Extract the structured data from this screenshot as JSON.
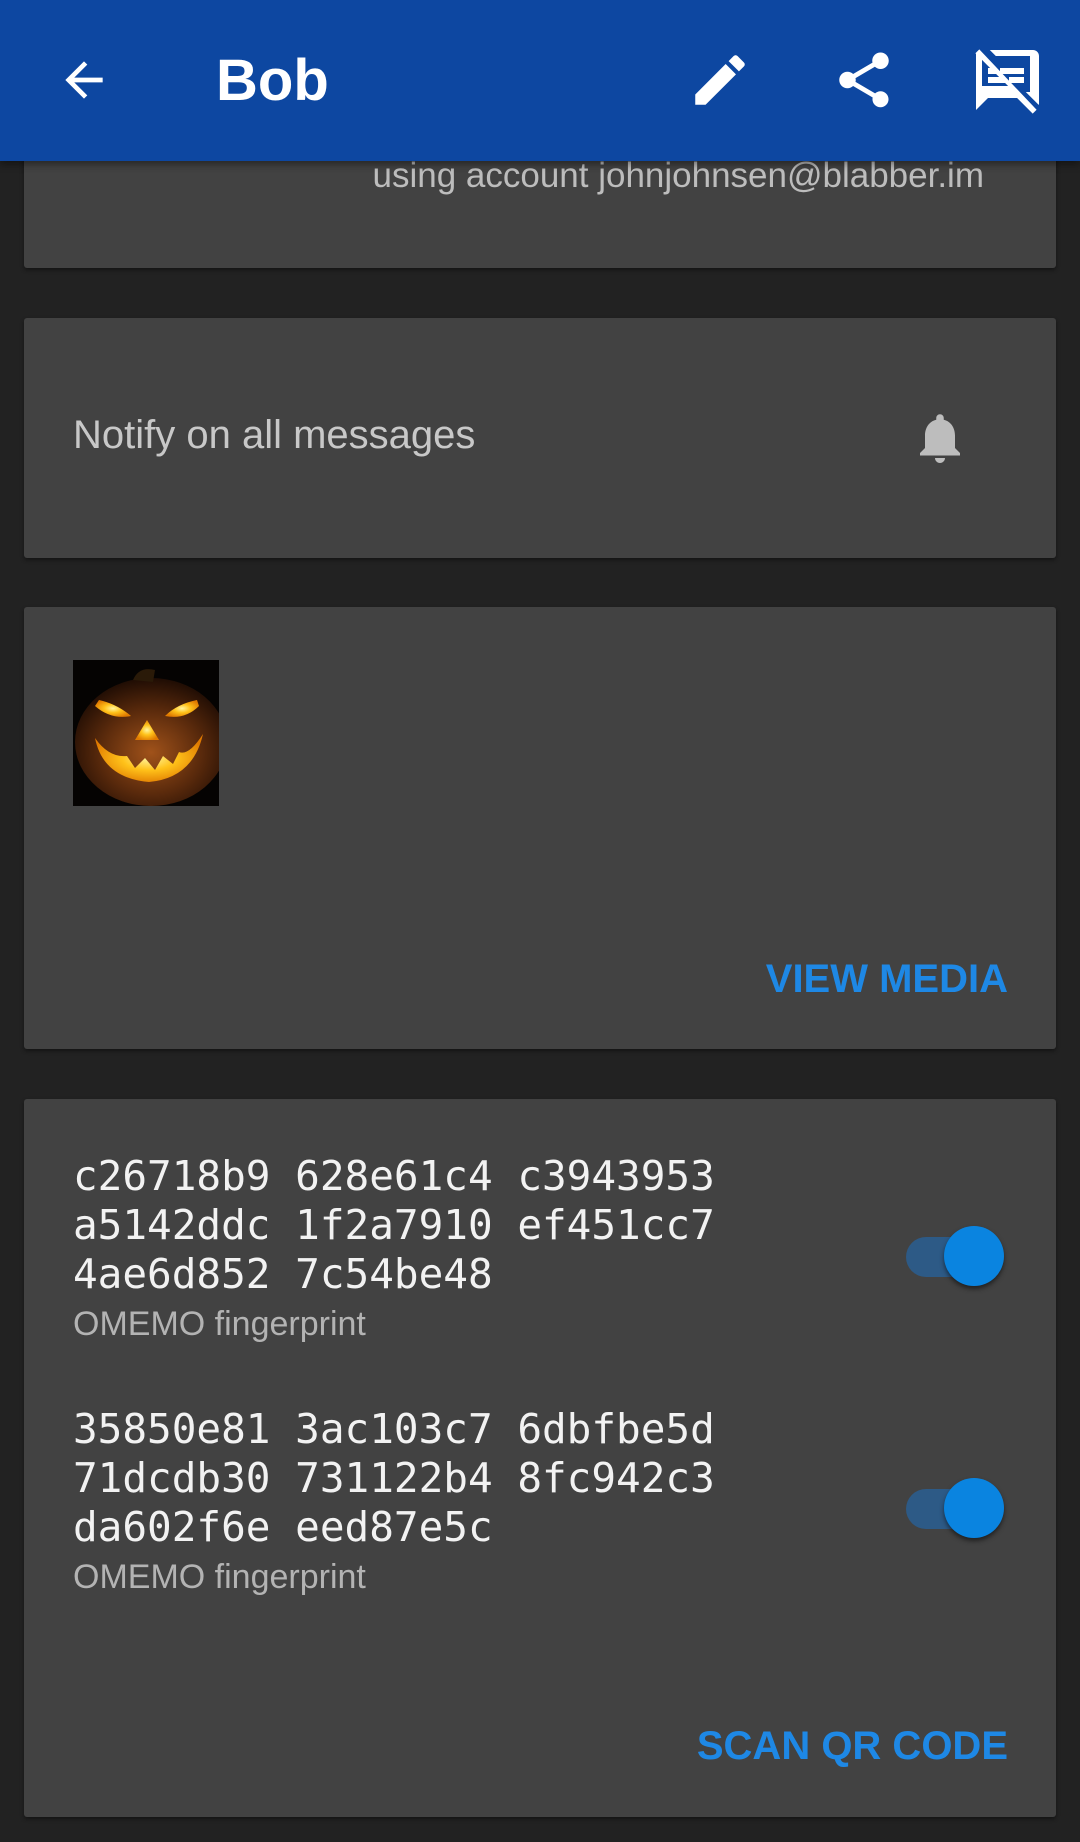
{
  "toolbar": {
    "title": "Bob",
    "back_icon": "arrow-back-icon",
    "edit_icon": "pencil-icon",
    "share_icon": "share-icon",
    "block_icon": "block-messages-icon"
  },
  "account": {
    "text": "using account johnjohnsen@blabber.im"
  },
  "notifications": {
    "label": "Notify on all messages",
    "icon": "bell-icon"
  },
  "media": {
    "thumbnail": "jack-o-lantern-image",
    "button_label": "VIEW MEDIA"
  },
  "keys": {
    "fingerprints": [
      {
        "lines": [
          "c26718b9 628e61c4 c3943953",
          "a5142ddc 1f2a7910 ef451cc7",
          "4ae6d852 7c54be48"
        ],
        "label": "OMEMO fingerprint",
        "trusted": true
      },
      {
        "lines": [
          "35850e81 3ac103c7 6dbfbe5d",
          "71dcdb30 731122b4 8fc942c3",
          "da602f6e eed87e5c"
        ],
        "label": "OMEMO fingerprint",
        "trusted": true
      }
    ],
    "scan_label": "SCAN QR CODE"
  },
  "colors": {
    "toolbar": "#0d47a1",
    "background": "#222222",
    "card": "#424242",
    "accent": "#1e88e5"
  }
}
